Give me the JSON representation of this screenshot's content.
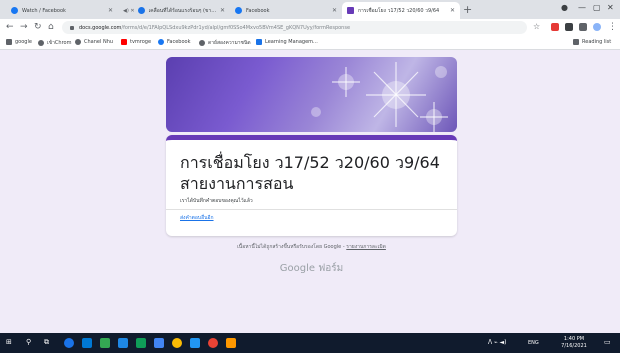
{
  "tabs": [
    {
      "label": "Watch / Facebook",
      "favicon_color": "#1877f2"
    },
    {
      "label": "เคลื่อนที่ได้ร้อนแรงร้อนๆ (ขาดเรียนใน x",
      "favicon_color": "#1a73e8",
      "extra": "◀) ✕"
    },
    {
      "label": "Facebook",
      "favicon_color": "#1877f2"
    },
    {
      "label": "การเชื่อมโยง ว17/52 ว20/60 ว9/64",
      "favicon_color": "#673ab7"
    }
  ],
  "address_bar": {
    "host": "docs.google.com",
    "path": "/forms/d/e/1FAIpQLSdxu9kzPdr1yd/alpl/gmf0SSo4Mxvo5BVm4SE_gKQN7Uyy/formResponse"
  },
  "bookmarks": [
    "google",
    "เข้าChrom",
    "Chanel Nhu",
    "tvmroge",
    "Facebook",
    "ดาย์สองความาชนิด",
    "Learning Managem..."
  ],
  "reading_list": "Reading list",
  "form": {
    "title": "การเชื่อมโยง ว17/52 ว20/60 ว9/64 สายงานการสอน",
    "confirmation": "เราได้บันทึกคำตอบของคุณไว้แล้ว",
    "edit_link": "ส่งคำตอบอื่นอีก",
    "footnote": "เนื้อหานี้ไม่ได้ถูกสร้างขึ้นหรือรับรองโดย Google",
    "footnote_link": "รายงานการละเมิด",
    "brand": "Google ฟอร์ม",
    "accent_color": "#673ab7"
  },
  "taskbar": {
    "time": "1:40 PM",
    "date": "7/16/2021",
    "tray": "ENG"
  },
  "colors": {
    "page_background": "#f0ebf8",
    "taskbar": "#101b2d",
    "link": "#1a73e8"
  }
}
